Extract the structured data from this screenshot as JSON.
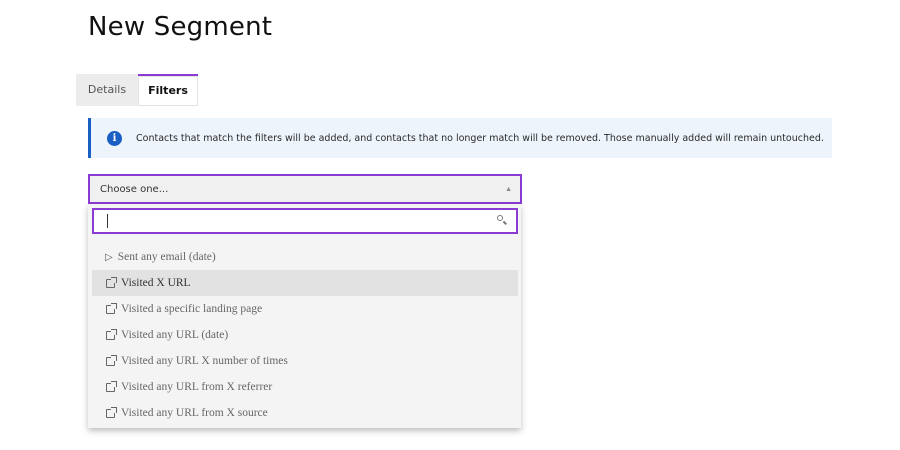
{
  "page": {
    "title": "New Segment"
  },
  "tabs": [
    {
      "label": "Details",
      "active": false
    },
    {
      "label": "Filters",
      "active": true
    }
  ],
  "alert": {
    "icon": "info-icon",
    "icon_glyph": "i",
    "text": "Contacts that match the filters will be added, and contacts that no longer match will be removed. Those manually added will remain untouched."
  },
  "filter_select": {
    "value": "Choose one...",
    "caret": "▲",
    "search": {
      "value": "",
      "placeholder": ""
    },
    "options": [
      {
        "label": "Sent any email (date)",
        "icon": "play-icon",
        "highlighted": false
      },
      {
        "label": "Visited X URL",
        "icon": "external-link-icon",
        "highlighted": true
      },
      {
        "label": "Visited a specific landing page",
        "icon": "external-link-icon",
        "highlighted": false
      },
      {
        "label": "Visited any URL (date)",
        "icon": "external-link-icon",
        "highlighted": false
      },
      {
        "label": "Visited any URL X number of times",
        "icon": "external-link-icon",
        "highlighted": false
      },
      {
        "label": "Visited any URL from X referrer",
        "icon": "external-link-icon",
        "highlighted": false
      },
      {
        "label": "Visited any URL from X source",
        "icon": "external-link-icon",
        "highlighted": false
      }
    ]
  },
  "colors": {
    "accent": "#8a3bd4",
    "info": "#1b5fc4",
    "alert_bg": "#eef4fc"
  }
}
